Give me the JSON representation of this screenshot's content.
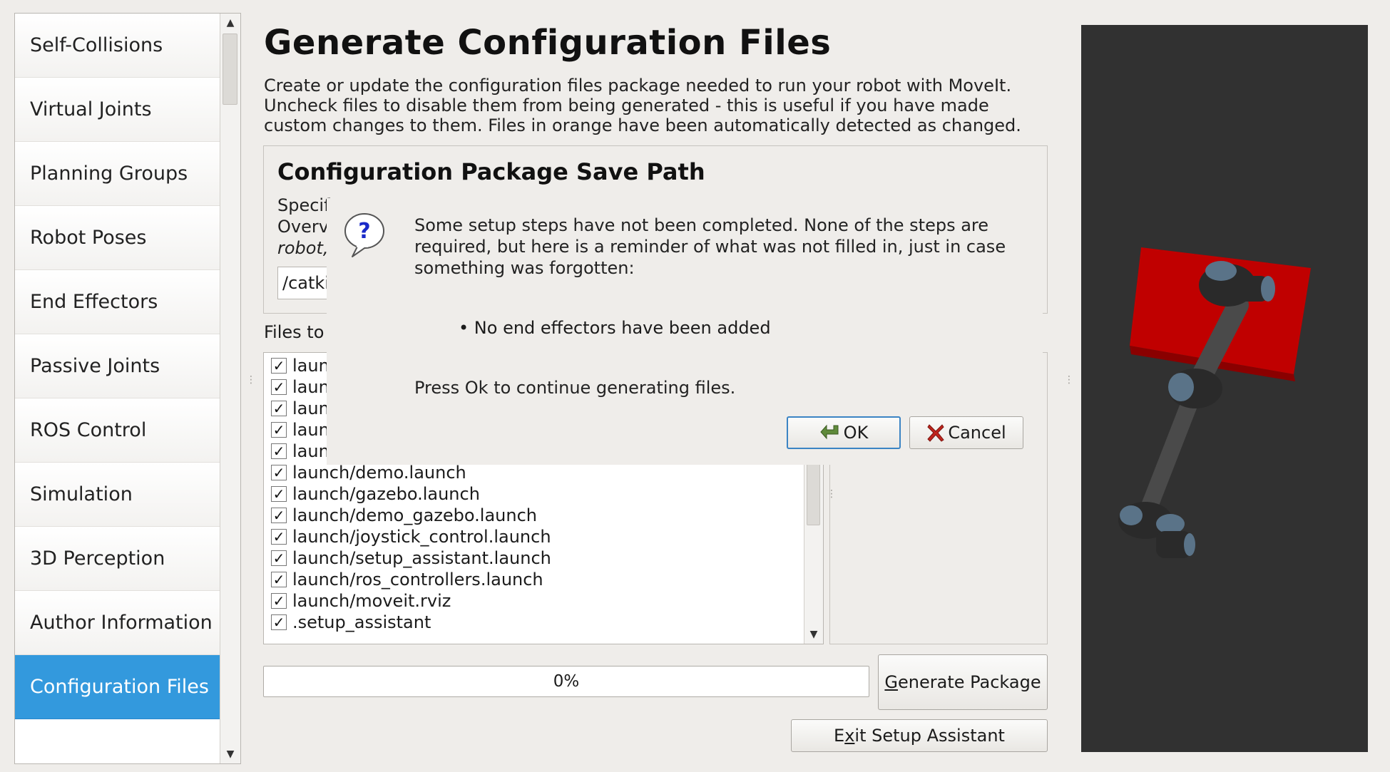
{
  "sidebar": {
    "items": [
      {
        "label": "Self-Collisions"
      },
      {
        "label": "Virtual Joints"
      },
      {
        "label": "Planning Groups"
      },
      {
        "label": "Robot Poses"
      },
      {
        "label": "End Effectors"
      },
      {
        "label": "Passive Joints"
      },
      {
        "label": "ROS Control"
      },
      {
        "label": "Simulation"
      },
      {
        "label": "3D Perception"
      },
      {
        "label": "Author Information"
      },
      {
        "label": "Configuration Files"
      }
    ],
    "selected": "Configuration Files"
  },
  "main": {
    "title": "Generate Configuration Files",
    "description_lines": [
      "Create or update the configuration files package needed to run your robot with MoveIt.",
      "Uncheck files to disable them from being generated - this is useful if you have made",
      "custom changes to them. Files in orange have been automatically detected as changed."
    ],
    "save_path": {
      "title": "Configuration Package Save Path",
      "desc_lines": [
        "Specif",
        "Overv",
        "robot,"
      ],
      "path_value": "/catki"
    },
    "files_label": "Files to",
    "files": [
      {
        "name": "laun",
        "checked": true
      },
      {
        "name": "laun",
        "checked": true
      },
      {
        "name": "laun",
        "checked": true
      },
      {
        "name": "laun",
        "checked": true
      },
      {
        "name": "laun",
        "checked": true
      },
      {
        "name": "launch/demo.launch",
        "checked": true
      },
      {
        "name": "launch/gazebo.launch",
        "checked": true
      },
      {
        "name": "launch/demo_gazebo.launch",
        "checked": true
      },
      {
        "name": "launch/joystick_control.launch",
        "checked": true
      },
      {
        "name": "launch/setup_assistant.launch",
        "checked": true
      },
      {
        "name": "launch/ros_controllers.launch",
        "checked": true
      },
      {
        "name": "launch/moveit.rviz",
        "checked": true
      },
      {
        "name": ".setup_assistant",
        "checked": true
      }
    ],
    "progress": {
      "value": 0,
      "label": "0%"
    },
    "generate_button": {
      "label_pre": "",
      "mnemonic": "G",
      "label_post": "enerate Package"
    },
    "exit_button": {
      "label_pre": "E",
      "mnemonic": "x",
      "label_post": "it Setup Assistant"
    }
  },
  "viewport": {
    "background": "#313131",
    "plate_color": "#c00000",
    "robot_color": "#4a4a4a",
    "joint_accent": "#5a7388"
  },
  "dialog": {
    "icon": "question-icon",
    "message_lines": [
      "Some setup steps have not been completed. None of the steps are",
      "required, but here is a reminder of what was not filled in, just in case",
      "something was forgotten:"
    ],
    "bullet": "No end effectors have been added",
    "footer": "Press Ok to continue generating files.",
    "ok_label": "OK",
    "cancel_label": "Cancel"
  },
  "colors": {
    "accent": "#3399dd",
    "background": "#efedea"
  }
}
